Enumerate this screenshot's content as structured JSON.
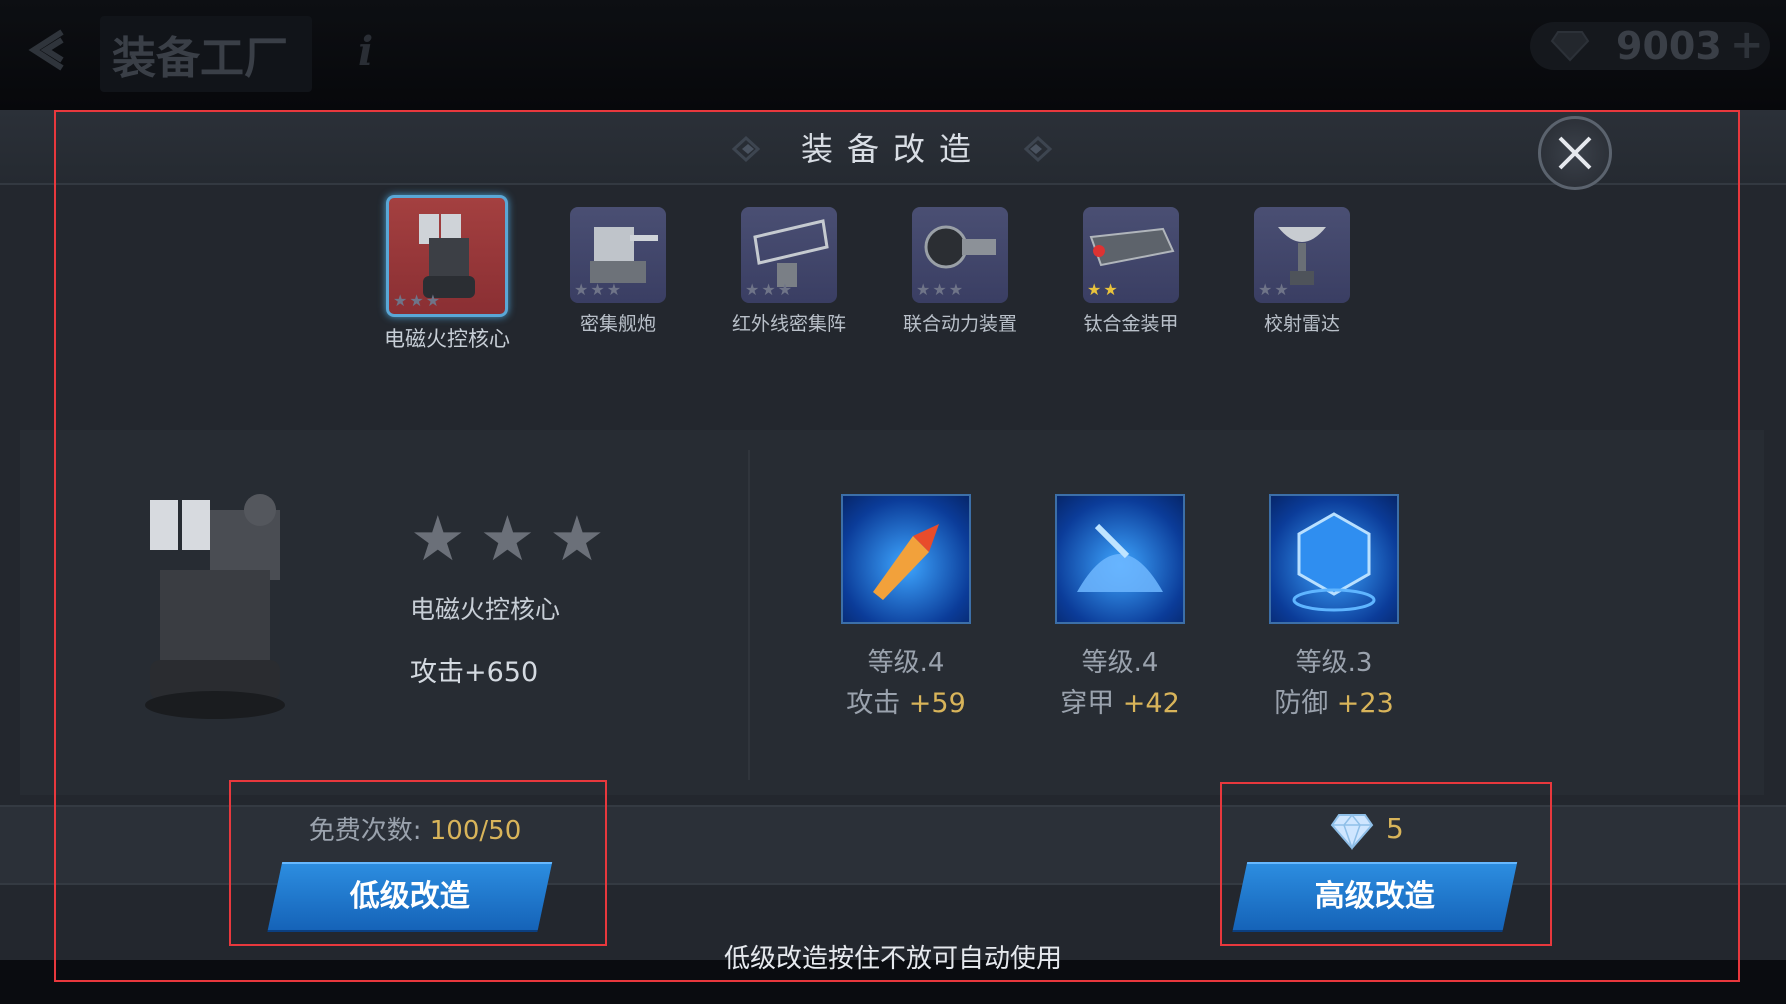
{
  "topbar": {
    "title": "装备工厂",
    "info": "i",
    "currency_value": "9003",
    "currency_plus": "+"
  },
  "modal": {
    "title": "装备改造"
  },
  "equipment": [
    {
      "name": "电磁火控核心",
      "stars": "★★★",
      "selected": true
    },
    {
      "name": "密集舰炮",
      "stars": "★★★"
    },
    {
      "name": "红外线密集阵",
      "stars": "★★★"
    },
    {
      "name": "联合动力装置",
      "stars": "★★★"
    },
    {
      "name": "钛合金装甲",
      "stars": "★★"
    },
    {
      "name": "校射雷达",
      "stars": "★★"
    }
  ],
  "detail": {
    "rating": "★★★",
    "name": "电磁火控核心",
    "attack": "攻击+650"
  },
  "skills": [
    {
      "level": "等级.4",
      "stat": "攻击",
      "bonus": "+59"
    },
    {
      "level": "等级.4",
      "stat": "穿甲",
      "bonus": "+42"
    },
    {
      "level": "等级.3",
      "stat": "防御",
      "bonus": "+23"
    }
  ],
  "low": {
    "free_label": "免费次数: ",
    "free_value": "100/50",
    "button": "低级改造"
  },
  "high": {
    "cost": "5",
    "button": "高级改造"
  },
  "hint": "低级改造按住不放可自动使用",
  "colors": {
    "accent_blue": "#1e78d0",
    "gold": "#d8b45a",
    "frame_red": "#e8383d"
  }
}
